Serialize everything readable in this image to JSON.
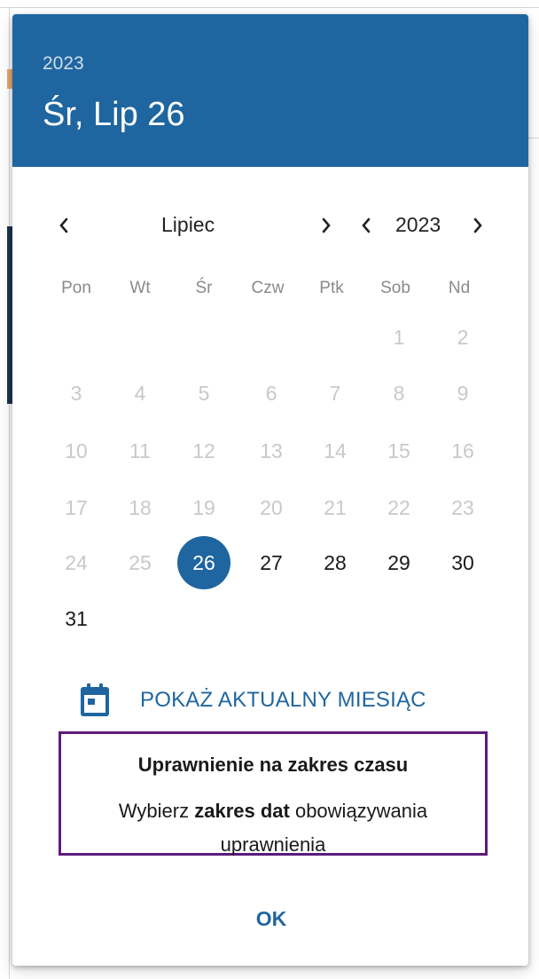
{
  "header": {
    "year": "2023",
    "date": "Śr, Lip 26"
  },
  "month_nav": {
    "label": "Lipiec"
  },
  "year_nav": {
    "label": "2023"
  },
  "weekdays": [
    "Pon",
    "Wt",
    "Śr",
    "Czw",
    "Ptk",
    "Sob",
    "Nd"
  ],
  "days": {
    "d1": "1",
    "d2": "2",
    "d3": "3",
    "d4": "4",
    "d5": "5",
    "d6": "6",
    "d7": "7",
    "d8": "8",
    "d9": "9",
    "d10": "10",
    "d11": "11",
    "d12": "12",
    "d13": "13",
    "d14": "14",
    "d15": "15",
    "d16": "16",
    "d17": "17",
    "d18": "18",
    "d19": "19",
    "d20": "20",
    "d21": "21",
    "d22": "22",
    "d23": "23",
    "d24": "24",
    "d25": "25",
    "d26": "26",
    "d27": "27",
    "d28": "28",
    "d29": "29",
    "d30": "30",
    "d31": "31"
  },
  "selected_day": "26",
  "today_button": {
    "label": "POKAŻ AKTUALNY MIESIĄC",
    "icon": "calendar-icon"
  },
  "tooltip": {
    "title": "Uprawnienie na zakres czasu",
    "body_prefix": "Wybierz ",
    "body_bold": "zakres dat",
    "body_suffix": " obowiązywania uprawnienia"
  },
  "ok_button": {
    "label": "OK"
  },
  "colors": {
    "primary": "#1f66a0",
    "tooltip_border": "#5e1a7c",
    "disabled_text": "#c9c9c9"
  }
}
